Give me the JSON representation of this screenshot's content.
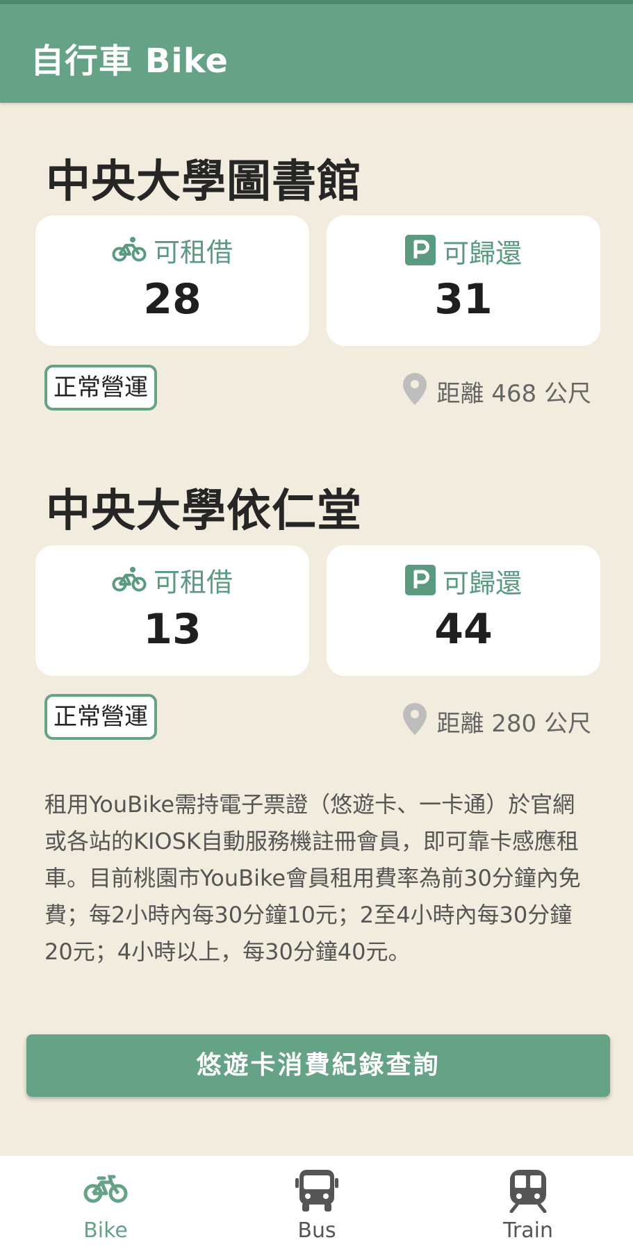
{
  "app_bar": {
    "title": "自行車 Bike"
  },
  "stations": [
    {
      "name": "中央大學圖書館",
      "rent": {
        "label": "可租借",
        "value": "28",
        "icon": "bicycle-icon"
      },
      "return": {
        "label": "可歸還",
        "value": "31",
        "icon": "parking-icon"
      },
      "status": "正常營運",
      "distance": "距離 468 公尺"
    },
    {
      "name": "中央大學依仁堂",
      "rent": {
        "label": "可租借",
        "value": "13",
        "icon": "bicycle-icon"
      },
      "return": {
        "label": "可歸還",
        "value": "44",
        "icon": "parking-icon"
      },
      "status": "正常營運",
      "distance": "距離 280 公尺"
    }
  ],
  "info_text": "租用YouBike需持電子票證（悠遊卡、一卡通）於官網或各站的KIOSK自動服務機註冊會員，即可靠卡感應租車。目前桃園市YouBike會員租用費率為前30分鐘內免費；每2小時內每30分鐘10元；2至4小時內每30分鐘20元；4小時以上，每30分鐘40元。",
  "action_button": {
    "label": "悠遊卡消費紀錄查詢"
  },
  "bottom_nav": [
    {
      "label": "Bike",
      "icon": "bicycle-icon",
      "active": true
    },
    {
      "label": "Bus",
      "icon": "bus-icon",
      "active": false
    },
    {
      "label": "Train",
      "icon": "train-icon",
      "active": false
    }
  ],
  "colors": {
    "primary": "#65a286",
    "background": "#f1ecdd",
    "inactive_nav": "#555555"
  }
}
